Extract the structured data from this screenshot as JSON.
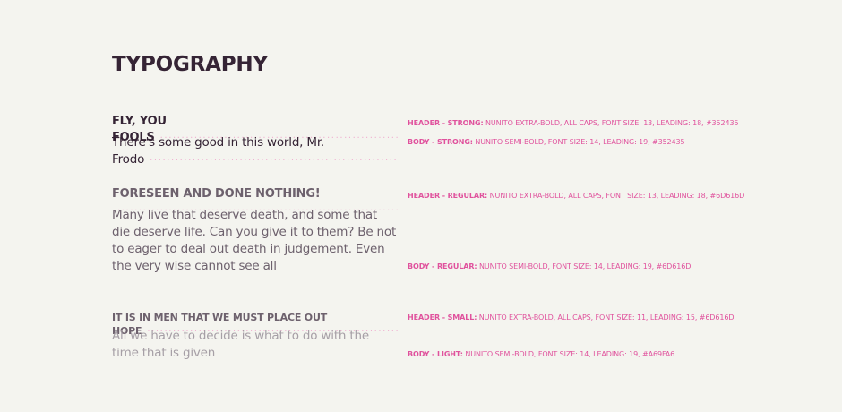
{
  "page": {
    "title": "TYPOGRAPHY"
  },
  "leader": "·····································································",
  "styles": [
    {
      "name": "HEADER - STRONG:",
      "spec": "NUNITO EXTRA-BOLD, ALL CAPS, FONT SIZE: 13, LEADING: 18, #352435",
      "sample": "FLY, YOU FOOLS"
    },
    {
      "name": "BODY - STRONG:",
      "spec": "NUNITO SEMI-BOLD, FONT SIZE: 14, LEADING: 19, #352435",
      "sample": "There's some good in this world, Mr. Frodo"
    },
    {
      "name": "HEADER - REGULAR:",
      "spec": "NUNITO EXTRA-BOLD, ALL CAPS, FONT SIZE: 13, LEADING: 18, #6D616D",
      "sample": "FORESEEN AND DONE NOTHING!"
    },
    {
      "name": "BODY - REGULAR:",
      "spec": "NUNITO SEMI-BOLD, FONT SIZE: 14, LEADING: 19, #6D616D",
      "sample": "Many live that deserve death, and some that die deserve life. Can you give it to them? Be not to eager to deal out death in judgement. Even the very wise cannot see all ends."
    },
    {
      "name": "HEADER - SMALL:",
      "spec": "NUNITO EXTRA-BOLD, ALL CAPS, FONT SIZE: 11, LEADING: 15, #6D616D",
      "sample": "IT IS IN MEN THAT WE MUST PLACE OUT HOPE"
    },
    {
      "name": "BODY - LIGHT:",
      "spec": "NUNITO SEMI-BOLD, FONT SIZE: 14, LEADING: 19, #A69FA6",
      "sample": "All we have to decide is what to do with the time that is given us"
    }
  ],
  "colors": {
    "background": "#f4f4ef",
    "strong": "#352435",
    "regular": "#6d616d",
    "light": "#a69fa6",
    "accent": "#e0529d",
    "leader": "#efb1d0"
  }
}
